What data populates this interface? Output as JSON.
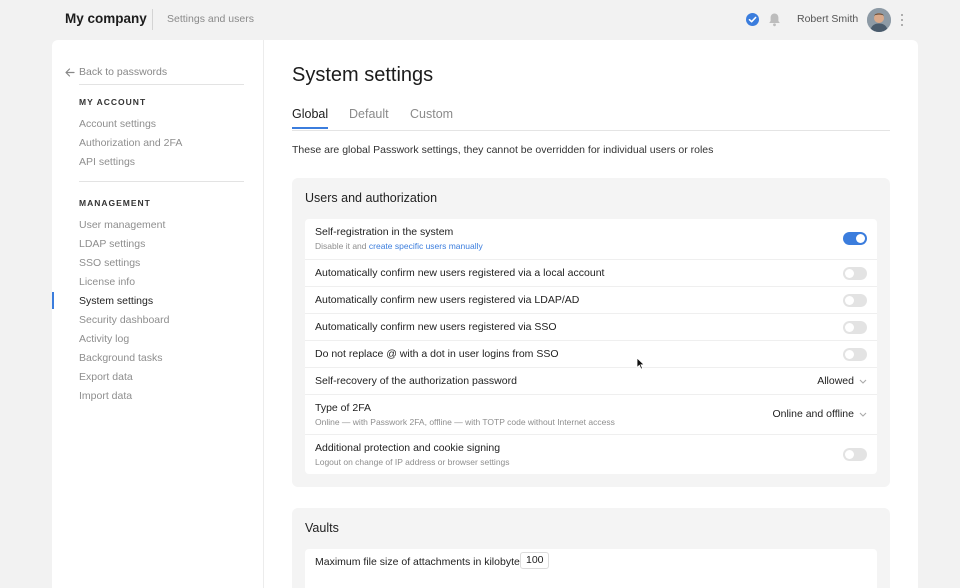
{
  "header": {
    "brand": "My company",
    "breadcrumb": "Settings and users",
    "user_name": "Robert Smith",
    "colors": {
      "accent": "#3b7ddd"
    }
  },
  "sidebar": {
    "back_label": "Back to passwords",
    "my_account": {
      "heading": "MY ACCOUNT",
      "items": [
        "Account settings",
        "Authorization and 2FA",
        "API settings"
      ]
    },
    "management": {
      "heading": "MANAGEMENT",
      "items": [
        "User management",
        "LDAP settings",
        "SSO settings",
        "License info",
        "System settings",
        "Security dashboard",
        "Activity log",
        "Background tasks",
        "Export data",
        "Import data"
      ],
      "active": "System settings"
    }
  },
  "main": {
    "title": "System settings",
    "tabs": [
      "Global",
      "Default",
      "Custom"
    ],
    "active_tab": "Global",
    "description": "These are global Passwork settings, they cannot be overridden for individual users or roles",
    "users_section": {
      "title": "Users and authorization",
      "rows": [
        {
          "label": "Self-registration in the system",
          "sub_prefix": "Disable it and",
          "sub_link": "create specific users manually",
          "control": "toggle",
          "on": true
        },
        {
          "label": "Automatically confirm new users registered via a local account",
          "control": "toggle",
          "on": false
        },
        {
          "label": "Automatically confirm new users registered via LDAP/AD",
          "control": "toggle",
          "on": false
        },
        {
          "label": "Automatically confirm new users registered via SSO",
          "control": "toggle",
          "on": false
        },
        {
          "label": "Do not replace @ with a dot in user logins from SSO",
          "control": "toggle",
          "on": false
        },
        {
          "label": "Self-recovery of the authorization password",
          "control": "select",
          "value": "Allowed"
        },
        {
          "label": "Type of 2FA",
          "sub": "Online — with Passwork 2FA, offline — with TOTP code without Internet access",
          "control": "select",
          "value": "Online and offline"
        },
        {
          "label": "Additional protection and cookie signing",
          "sub": "Logout on change of IP address or browser settings",
          "control": "toggle",
          "on": false
        }
      ]
    },
    "vaults_section": {
      "title": "Vaults",
      "max_file_label": "Maximum file size of attachments in kilobytes",
      "max_file_value": "100"
    }
  }
}
